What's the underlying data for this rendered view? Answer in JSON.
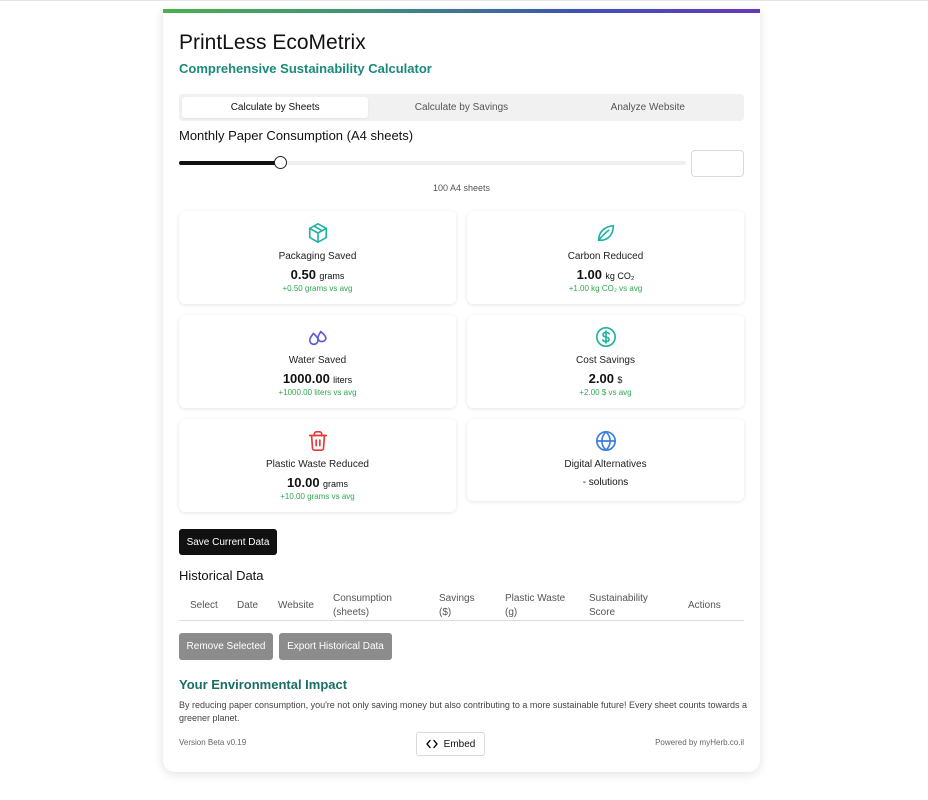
{
  "app": {
    "title": "PrintLess EcoMetrix",
    "subtitle": "Comprehensive Sustainability Calculator"
  },
  "tabs": [
    {
      "label": "Calculate by Sheets",
      "active": true
    },
    {
      "label": "Calculate by Savings",
      "active": false
    },
    {
      "label": "Analyze Website",
      "active": false
    }
  ],
  "slider": {
    "label": "Monthly Paper Consumption (A4 sheets)",
    "value_text": "100 A4 sheets",
    "fraction": 0.2,
    "input_value": ""
  },
  "metrics": {
    "packaging": {
      "label": "Packaging Saved",
      "value": "0.50",
      "unit": "grams",
      "comparison": "+0.50 grams vs avg",
      "icon": "package-icon",
      "color": "#20b2a0"
    },
    "carbon": {
      "label": "Carbon Reduced",
      "value": "1.00",
      "unit": "kg CO₂",
      "comparison": "+1.00 kg CO₂ vs avg",
      "icon": "leaf-icon",
      "color": "#20b2a0"
    },
    "water": {
      "label": "Water Saved",
      "value": "1000.00",
      "unit": "liters",
      "comparison": "+1000.00 liters vs avg",
      "icon": "droplets-icon",
      "color": "#5b5bd6"
    },
    "cost": {
      "label": "Cost Savings",
      "value": "2.00",
      "unit": "$",
      "comparison": "+2.00 $ vs avg",
      "icon": "dollar-icon",
      "color": "#20b2a0"
    },
    "plastic": {
      "label": "Plastic Waste Reduced",
      "value": "10.00",
      "unit": "grams",
      "comparison": "+10.00 grams vs avg",
      "icon": "trash-icon",
      "color": "#e53935"
    },
    "digital": {
      "label": "Digital Alternatives",
      "value_text": "- solutions",
      "icon": "globe-icon",
      "color": "#3b7de0"
    }
  },
  "buttons": {
    "save": "Save Current Data",
    "remove": "Remove Selected",
    "export": "Export Historical Data",
    "embed": "Embed"
  },
  "history": {
    "title": "Historical Data",
    "columns": [
      "Select",
      "Date",
      "Website",
      "Consumption (sheets)",
      "Savings ($)",
      "Plastic Waste (g)",
      "Sustainability Score",
      "Actions"
    ],
    "rows": []
  },
  "impact": {
    "title": "Your Environmental Impact",
    "text": "By reducing paper consumption, you're not only saving money but also contributing to a more sustainable future! Every sheet counts towards a greener planet."
  },
  "footer": {
    "version": "Version Beta v0.19",
    "powered": "Powered by myHerb.co.il"
  }
}
